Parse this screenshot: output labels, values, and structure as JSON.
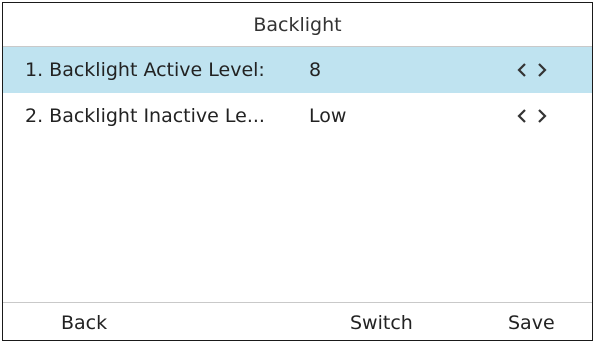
{
  "title": "Backlight",
  "items": [
    {
      "label": "1. Backlight Active Level:",
      "value": "8",
      "selected": true
    },
    {
      "label": "2. Backlight Inactive Le...",
      "value": "Low",
      "selected": false
    }
  ],
  "icons": {
    "prev": "chevron-left-icon",
    "next": "chevron-right-icon"
  },
  "softkeys": {
    "back": "Back",
    "switch": "Switch",
    "save": "Save"
  },
  "colors": {
    "selected_row": "#bfe3f0",
    "text": "#222222",
    "divider": "#c9c9c9"
  }
}
